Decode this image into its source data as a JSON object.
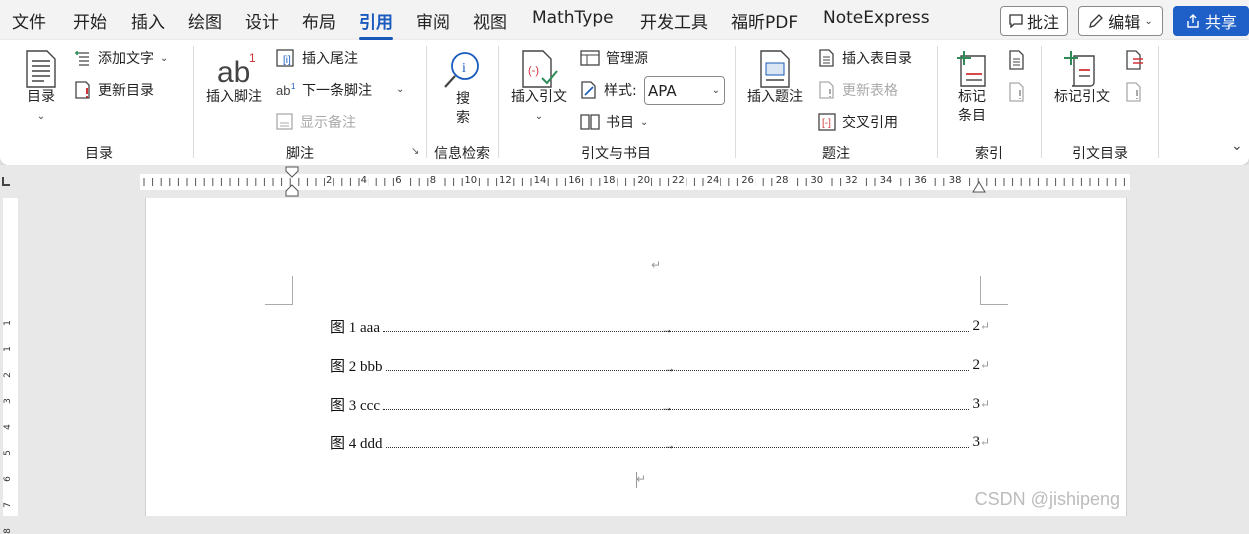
{
  "menu": {
    "tabs": [
      "文件",
      "开始",
      "插入",
      "绘图",
      "设计",
      "布局",
      "引用",
      "审阅",
      "视图",
      "MathType",
      "开发工具",
      "福昕PDF",
      "NoteExpress"
    ],
    "active_tab": "引用",
    "comment_label": "批注",
    "edit_label": "编辑",
    "share_label": "共享"
  },
  "ribbon": {
    "toc": {
      "group_label": "目录",
      "toc_btn": "目录",
      "add_text": "添加文字",
      "update_toc": "更新目录"
    },
    "footnote": {
      "group_label": "脚注",
      "insert_footnote": "插入脚注",
      "insert_endnote": "插入尾注",
      "next_footnote": "下一条脚注",
      "show_notes": "显示备注"
    },
    "search": {
      "group_label": "信息检索",
      "btn_line1": "搜",
      "btn_line2": "索"
    },
    "citation": {
      "group_label": "引文与书目",
      "insert_citation": "插入引文",
      "manage_sources": "管理源",
      "style_label": "样式:",
      "style_value": "APA",
      "bibliography": "书目"
    },
    "caption": {
      "group_label": "题注",
      "insert_caption": "插入题注",
      "insert_tof": "插入表目录",
      "update_table": "更新表格",
      "cross_ref": "交叉引用"
    },
    "index": {
      "group_label": "索引",
      "mark_entry_line1": "标记",
      "mark_entry_line2": "条目"
    },
    "toa": {
      "group_label": "引文目录",
      "mark_citation": "标记引文"
    }
  },
  "document": {
    "entries": [
      {
        "label": "图 1 aaa",
        "page": "2"
      },
      {
        "label": "图 2 bbb",
        "page": "2"
      },
      {
        "label": "图 3 ccc",
        "page": "3"
      },
      {
        "label": "图 4 ddd",
        "page": "3"
      }
    ],
    "tab_arrow": "→",
    "para_mark": "↵"
  },
  "ruler": {
    "numbers": [
      "2",
      "4",
      "6",
      "8",
      "10",
      "12",
      "14",
      "16",
      "18",
      "20",
      "22",
      "24",
      "26",
      "28",
      "30",
      "32",
      "34",
      "36",
      "38"
    ],
    "vnumbers": [
      "1",
      "1",
      "2",
      "3",
      "4",
      "5",
      "6",
      "7",
      "8"
    ]
  },
  "watermark": "CSDN @jishipeng",
  "colors": {
    "accent": "#185abd",
    "share": "#1e5fc8",
    "red": "#d13438"
  }
}
